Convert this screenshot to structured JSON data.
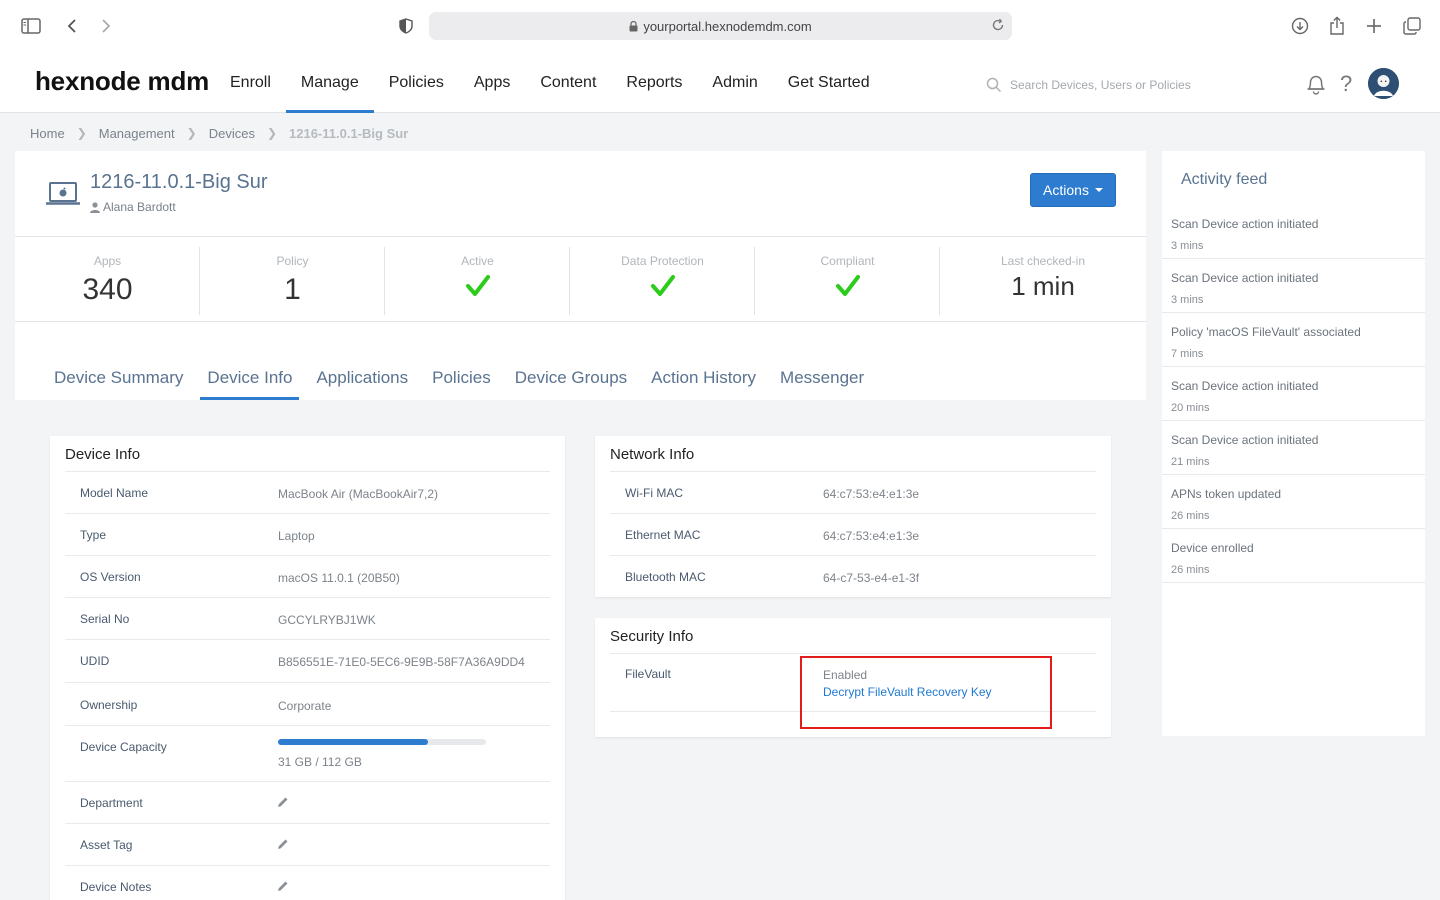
{
  "browser": {
    "url": "yourportal.hexnodemdm.com"
  },
  "app": {
    "logo": "hexnode mdm",
    "nav": [
      "Enroll",
      "Manage",
      "Policies",
      "Apps",
      "Content",
      "Reports",
      "Admin",
      "Get Started"
    ],
    "active_nav": "Manage",
    "search_placeholder": "Search Devices, Users or Policies"
  },
  "breadcrumb": [
    "Home",
    "Management",
    "Devices",
    "1216-11.0.1-Big Sur"
  ],
  "device": {
    "name": "1216-11.0.1-Big Sur",
    "owner": "Alana Bardott",
    "actions_label": "Actions"
  },
  "stats": {
    "apps": {
      "label": "Apps",
      "value": "340"
    },
    "policy": {
      "label": "Policy",
      "value": "1"
    },
    "active": {
      "label": "Active"
    },
    "data_protection": {
      "label": "Data Protection"
    },
    "compliant": {
      "label": "Compliant"
    },
    "last_checked": {
      "label": "Last checked-in",
      "value": "1 min"
    },
    "check_color": "#2ecc1a"
  },
  "tabs": [
    "Device Summary",
    "Device Info",
    "Applications",
    "Policies",
    "Device Groups",
    "Action History",
    "Messenger"
  ],
  "active_tab": "Device Info",
  "device_info": {
    "title": "Device Info",
    "rows": [
      {
        "label": "Model Name",
        "value": "MacBook Air (MacBookAir7,2)"
      },
      {
        "label": "Type",
        "value": "Laptop"
      },
      {
        "label": "OS Version",
        "value": "macOS 11.0.1 (20B50)"
      },
      {
        "label": "Serial No",
        "value": "GCCYLRYBJ1WK"
      },
      {
        "label": "UDID",
        "value": "B856551E-71E0-5EC6-9E9B-58F7A36A9DD4"
      },
      {
        "label": "Ownership",
        "value": "Corporate"
      },
      {
        "label": "Device Capacity",
        "value": "31 GB / 112 GB",
        "used_fraction": 0.72
      },
      {
        "label": "Department"
      },
      {
        "label": "Asset Tag"
      },
      {
        "label": "Device Notes"
      }
    ]
  },
  "network_info": {
    "title": "Network Info",
    "rows": [
      {
        "label": "Wi-Fi MAC",
        "value": "64:c7:53:e4:e1:3e"
      },
      {
        "label": "Ethernet MAC",
        "value": "64:c7:53:e4:e1:3e"
      },
      {
        "label": "Bluetooth MAC",
        "value": "64-c7-53-e4-e1-3f"
      }
    ]
  },
  "security_info": {
    "title": "Security Info",
    "filevault_label": "FileVault",
    "filevault_status": "Enabled",
    "filevault_link": "Decrypt FileVault Recovery Key"
  },
  "activity_feed": {
    "title": "Activity feed",
    "items": [
      {
        "text": "Scan Device action initiated",
        "time": "3 mins"
      },
      {
        "text": "Scan Device action initiated",
        "time": "3 mins"
      },
      {
        "text": "Policy 'macOS FileVault' associated",
        "time": "7 mins"
      },
      {
        "text": "Scan Device action initiated",
        "time": "20 mins"
      },
      {
        "text": "Scan Device action initiated",
        "time": "21 mins"
      },
      {
        "text": "APNs token updated",
        "time": "26 mins"
      },
      {
        "text": "Device enrolled",
        "time": "26 mins"
      }
    ]
  },
  "colors": {
    "accent": "#2d7ccf",
    "highlight": "#e31b1b",
    "link": "#1f79d1"
  }
}
